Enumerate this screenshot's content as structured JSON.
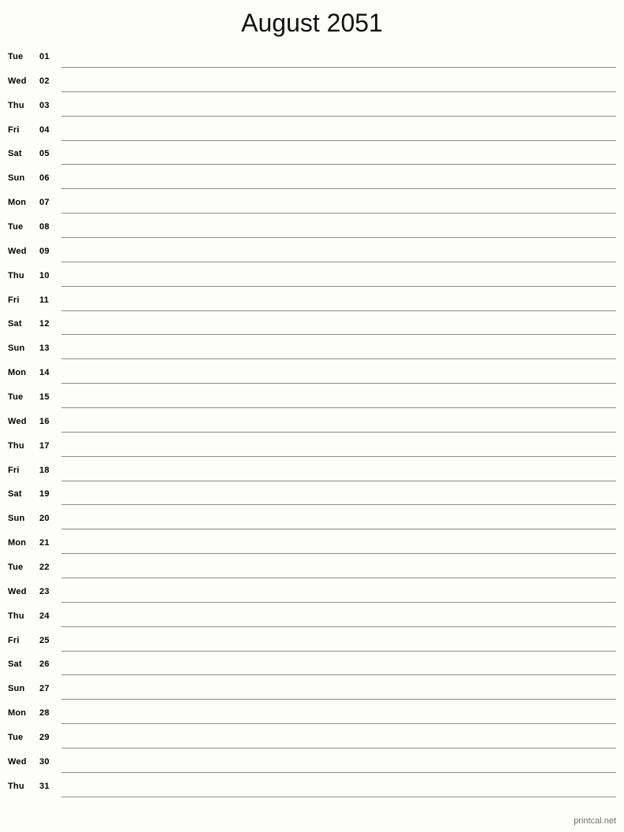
{
  "page": {
    "title": "August 2051",
    "month": "August",
    "year": "2051",
    "background_color": "#fdfefb",
    "rule_color": "#8a8f8a",
    "text_color": "#000000"
  },
  "footer": {
    "credit": "printcal.net",
    "color": "#6f6f6f"
  },
  "days": [
    {
      "weekday": "Tue",
      "number": "01"
    },
    {
      "weekday": "Wed",
      "number": "02"
    },
    {
      "weekday": "Thu",
      "number": "03"
    },
    {
      "weekday": "Fri",
      "number": "04"
    },
    {
      "weekday": "Sat",
      "number": "05"
    },
    {
      "weekday": "Sun",
      "number": "06"
    },
    {
      "weekday": "Mon",
      "number": "07"
    },
    {
      "weekday": "Tue",
      "number": "08"
    },
    {
      "weekday": "Wed",
      "number": "09"
    },
    {
      "weekday": "Thu",
      "number": "10"
    },
    {
      "weekday": "Fri",
      "number": "11"
    },
    {
      "weekday": "Sat",
      "number": "12"
    },
    {
      "weekday": "Sun",
      "number": "13"
    },
    {
      "weekday": "Mon",
      "number": "14"
    },
    {
      "weekday": "Tue",
      "number": "15"
    },
    {
      "weekday": "Wed",
      "number": "16"
    },
    {
      "weekday": "Thu",
      "number": "17"
    },
    {
      "weekday": "Fri",
      "number": "18"
    },
    {
      "weekday": "Sat",
      "number": "19"
    },
    {
      "weekday": "Sun",
      "number": "20"
    },
    {
      "weekday": "Mon",
      "number": "21"
    },
    {
      "weekday": "Tue",
      "number": "22"
    },
    {
      "weekday": "Wed",
      "number": "23"
    },
    {
      "weekday": "Thu",
      "number": "24"
    },
    {
      "weekday": "Fri",
      "number": "25"
    },
    {
      "weekday": "Sat",
      "number": "26"
    },
    {
      "weekday": "Sun",
      "number": "27"
    },
    {
      "weekday": "Mon",
      "number": "28"
    },
    {
      "weekday": "Tue",
      "number": "29"
    },
    {
      "weekday": "Wed",
      "number": "30"
    },
    {
      "weekday": "Thu",
      "number": "31"
    }
  ]
}
